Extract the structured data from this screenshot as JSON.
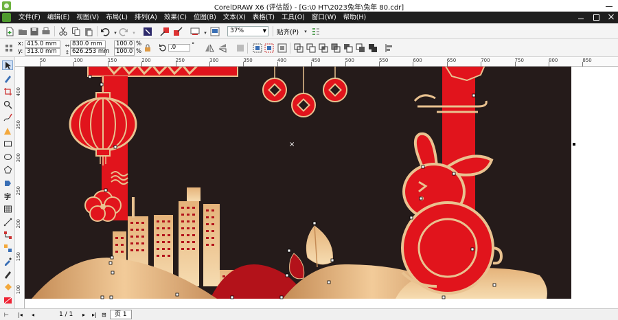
{
  "window": {
    "title": "CorelDRAW X6 (评估版) - [G:\\0 HT\\2023兔年\\兔年 80.cdr]"
  },
  "menu": [
    "文件(F)",
    "编辑(E)",
    "视图(V)",
    "布局(L)",
    "排列(A)",
    "效果(C)",
    "位图(B)",
    "文本(X)",
    "表格(T)",
    "工具(O)",
    "窗口(W)",
    "帮助(H)"
  ],
  "standard_toolbar": {
    "zoom_level": "37%",
    "snap_label": "贴齐(P)",
    "icons": [
      "new-document-icon",
      "open-icon",
      "save-icon",
      "print-icon",
      "cut-icon",
      "copy-icon",
      "paste-icon",
      "undo-icon",
      "redo-icon",
      "search-content-icon",
      "import-icon",
      "export-icon",
      "publish-pdf-icon",
      "application-launcher-icon",
      "welcome-screen-icon",
      "options-icon"
    ]
  },
  "property_bar": {
    "x_label": "x:",
    "x_value": "415.0 mm",
    "y_label": "y:",
    "y_value": "313.0 mm",
    "width_value": "830.0 mm",
    "height_value": "626.253 mm",
    "scale_x": "100.0",
    "scale_y": "100.0",
    "percent_symbol": "%",
    "rotation_value": ".0",
    "degree_symbol": "°"
  },
  "ruler": {
    "h_labels": [
      "50",
      "100",
      "150",
      "200",
      "250",
      "300",
      "350",
      "400",
      "450",
      "500",
      "550",
      "600",
      "650",
      "700",
      "750",
      "800",
      "850"
    ],
    "v_labels": [
      "400",
      "350",
      "300",
      "250",
      "200",
      "150",
      "100",
      "50"
    ]
  },
  "toolbox": [
    "pick-tool-icon",
    "shape-tool-icon",
    "crop-tool-icon",
    "zoom-tool-icon",
    "freehand-tool-icon",
    "smart-fill-icon",
    "rectangle-tool-icon",
    "ellipse-tool-icon",
    "polygon-tool-icon",
    "basic-shapes-icon",
    "text-tool-icon",
    "table-tool-icon",
    "parallel-dimension-icon",
    "connector-tool-icon",
    "blend-tool-icon",
    "eyedropper-tool-icon",
    "outline-pen-icon",
    "fill-tool-icon",
    "interactive-fill-icon"
  ],
  "status": {
    "page_counter": "1 / 1",
    "page_tab": "页 1"
  },
  "colors": {
    "artwork_background": "#251b1a",
    "festive_red": "#e1141c",
    "gold": "#e9c290",
    "dark_red": "#b3121a"
  }
}
